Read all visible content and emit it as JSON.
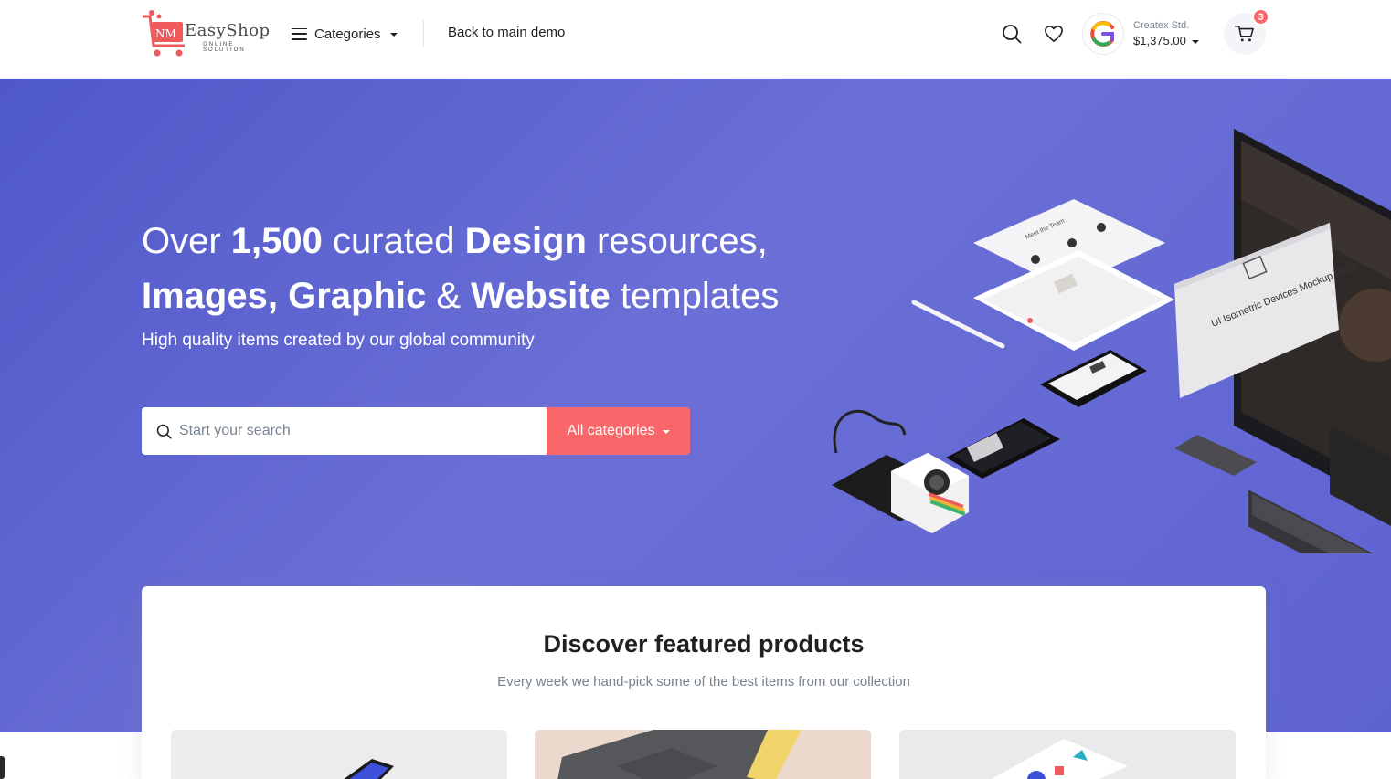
{
  "header": {
    "logo": {
      "monogram": "NM",
      "name": "EasyShop",
      "tagline": "ONLINE SOLUTION",
      "icon": "shopping-cart-logo"
    },
    "categories_label": "Categories",
    "back_link": "Back to main demo",
    "account": {
      "name": "Createx Std.",
      "balance": "$1,375.00"
    },
    "cart_count": "3",
    "icons": [
      "search-icon",
      "heart-icon",
      "cart-icon",
      "hamburger-icon",
      "chevron-down-icon"
    ]
  },
  "hero": {
    "title_line1": {
      "pre": "Over ",
      "bold1": "1,500",
      "mid": " curated ",
      "bold2": "Design",
      "post": " resources,"
    },
    "title_line2": {
      "bold1": "Images, Graphic",
      "mid": " & ",
      "bold2": "Website",
      "post": " templates"
    },
    "subtitle": "High quality items created by our global community",
    "search": {
      "placeholder": "Start your search",
      "category_button": "All categories"
    },
    "art": {
      "mockup_card_title": "UI Isometric Devices Mockup Pack",
      "tablet_heading": "Meet the Team"
    }
  },
  "featured": {
    "title": "Discover featured products",
    "subtitle": "Every week we hand-pick some of the best items from our collection"
  },
  "colors": {
    "accent": "#f9676b",
    "hero_bg": "#5e63d2",
    "text_dark": "#1e2022",
    "text_muted": "#77838f"
  }
}
